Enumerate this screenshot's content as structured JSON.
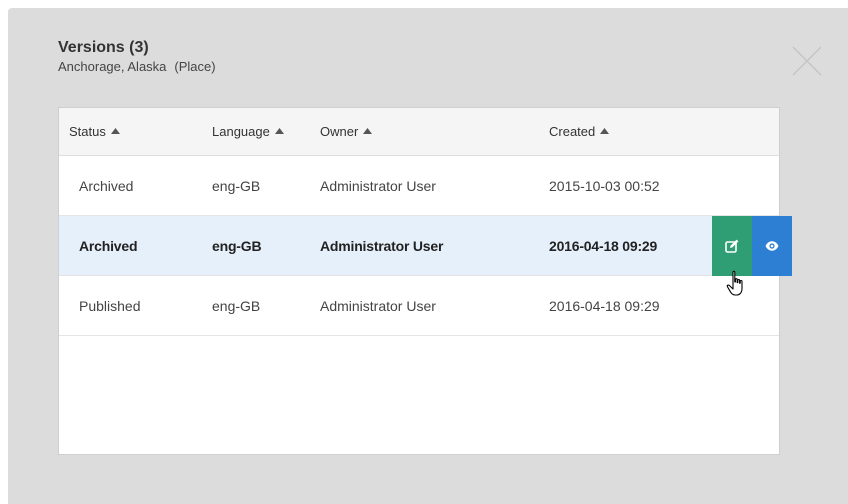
{
  "modal": {
    "title": "Versions (3)",
    "subtitle_name": "Anchorage, Alaska",
    "subtitle_type": "(Place)"
  },
  "table": {
    "columns": [
      {
        "label": "Status"
      },
      {
        "label": "Language"
      },
      {
        "label": "Owner"
      },
      {
        "label": "Created"
      }
    ],
    "rows": [
      {
        "status": "Archived",
        "language": "eng-GB",
        "owner": "Administrator User",
        "created": "2015-10-03 00:52",
        "selected": false
      },
      {
        "status": "Archived",
        "language": "eng-GB",
        "owner": "Administrator User",
        "created": "2016-04-18 09:29",
        "selected": true
      },
      {
        "status": "Published",
        "language": "eng-GB",
        "owner": "Administrator User",
        "created": "2016-04-18 09:29",
        "selected": false
      }
    ]
  },
  "icons": {
    "close": "close-icon",
    "sort": "caret-up-icon",
    "edit": "edit-icon",
    "view": "eye-icon",
    "cursor": "hand-pointer-icon"
  },
  "colors": {
    "overlay": "#dcdcdc",
    "header_bg": "#f5f5f5",
    "selected_row": "#e6f0fb",
    "edit_button": "#2f9e74",
    "view_button": "#2d7fd3"
  }
}
